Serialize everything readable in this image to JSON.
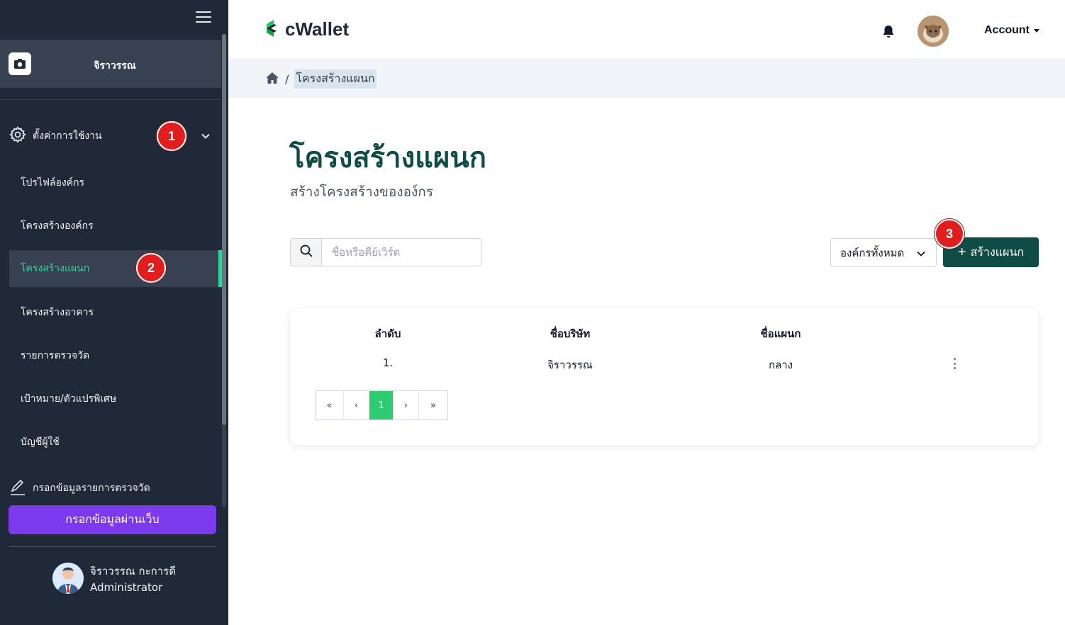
{
  "sidebar": {
    "org_name": "จิราวรรณ",
    "settings_label": "ตั้งค่าการใช้งาน",
    "items": [
      {
        "label": "โปรไฟล์องค์กร"
      },
      {
        "label": "โครงสร้างองค์กร"
      },
      {
        "label": "โครงสร้างแผนก"
      },
      {
        "label": "โครงสร้างอาคาร"
      },
      {
        "label": "รายการตรวจวัด"
      },
      {
        "label": "เป้าหมาย/ตัวแปรพิเศษ"
      },
      {
        "label": "บัญชีผู้ใช้"
      }
    ],
    "active_index": 2,
    "input_section_label": "กรอกข้อมูลรายการตรวจวัด",
    "web_input_button": "กรอกข้อมูลผ่านเว็บ",
    "user": {
      "name": "จิราวรรณ กะการดี",
      "role": "Administrator"
    }
  },
  "badges": {
    "one": "1",
    "two": "2",
    "three": "3"
  },
  "header": {
    "logo_text": "cWallet",
    "account_label": "Account"
  },
  "breadcrumb": {
    "separator": "/",
    "current": "โครงสร้างแผนก"
  },
  "page": {
    "title": "โครงสร้างแผนก",
    "subtitle": "สร้างโครงสร้างขององ์กร"
  },
  "search": {
    "placeholder": "ชื่อหรือคีย์เวิร์ด"
  },
  "filter": {
    "selected": "องค์กรทั้งหมด"
  },
  "create_button": {
    "icon": "+",
    "label": "สร้างแผนก"
  },
  "table": {
    "headers": [
      "ลำดับ",
      "ชื่อบริษัท",
      "ชื่อแผนก"
    ],
    "rows": [
      [
        "1.",
        "จิราวรรณ",
        "กลาง"
      ]
    ]
  },
  "pagination": {
    "first": "«",
    "prev": "‹",
    "current": "1",
    "next": "›",
    "last": "»"
  },
  "colors": {
    "sidebar_bg": "#1f2937",
    "accent_green": "#34d399",
    "primary_dark_green": "#0f4c45",
    "purple_button": "#7c3aed",
    "badge_red": "#e11d1d",
    "pager_active": "#2ecc71"
  }
}
